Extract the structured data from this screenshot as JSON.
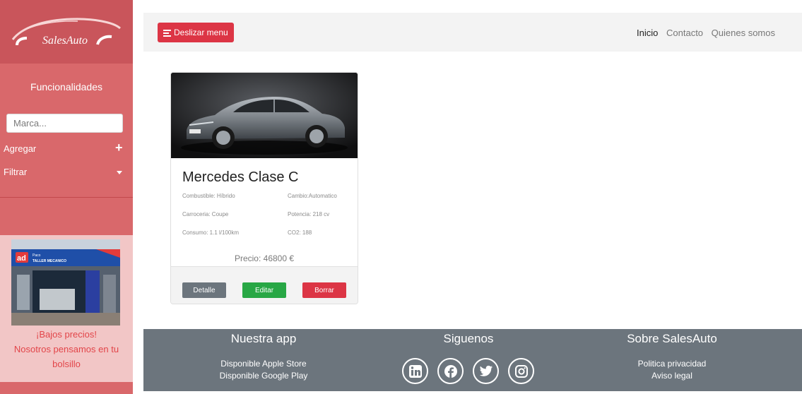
{
  "sidebar": {
    "logo_text": "SalesAuto",
    "section_title": "Funcionalidades",
    "brand_placeholder": "Marca...",
    "add_label": "Agregar",
    "filter_label": "Filtrar",
    "promo_lines": [
      "¡Bajos precios!",
      "Nosotros pensamos en tu",
      "bolsillo"
    ],
    "promo_sign_small": "Paco",
    "promo_sign_big": "TALLER MECANICO",
    "promo_sign_logo": "ad"
  },
  "topnav": {
    "slide_button": "Deslizar menu",
    "links": [
      "Inicio",
      "Contacto",
      "Quienes somos"
    ],
    "active_link": "Inicio"
  },
  "card": {
    "title": "Mercedes Clase C",
    "specs": {
      "fuel": "Combustible: Híbrido",
      "gearbox": "Cambio:Automatico",
      "body": "Carroceria: Coupe",
      "power": "Potencia: 218 cv",
      "consumption": "Consumo: 1.1 l/100km",
      "co2": "CO2: 188"
    },
    "price": "Precio: 46800 €",
    "buttons": {
      "detail": "Detalle",
      "edit": "Editar",
      "delete": "Borrar"
    }
  },
  "footer": {
    "app": {
      "heading": "Nuestra app",
      "apple": "Disponible Apple Store",
      "google": "Disponible Google Play"
    },
    "follow": {
      "heading": "Siguenos",
      "icons": [
        "linkedin-icon",
        "facebook-icon",
        "twitter-icon",
        "instagram-icon"
      ]
    },
    "about": {
      "heading": "Sobre SalesAuto",
      "privacy": "Politica privacidad",
      "legal": "Aviso legal"
    }
  },
  "colors": {
    "sidebar": "#d9686b",
    "sidebar_logo": "#c9555b",
    "promo_bg": "#f2c6c6",
    "promo_text": "#e24549",
    "danger": "#dc3545",
    "success": "#28a745",
    "secondary": "#6c757d",
    "nav_bg": "#f3f3f3"
  }
}
